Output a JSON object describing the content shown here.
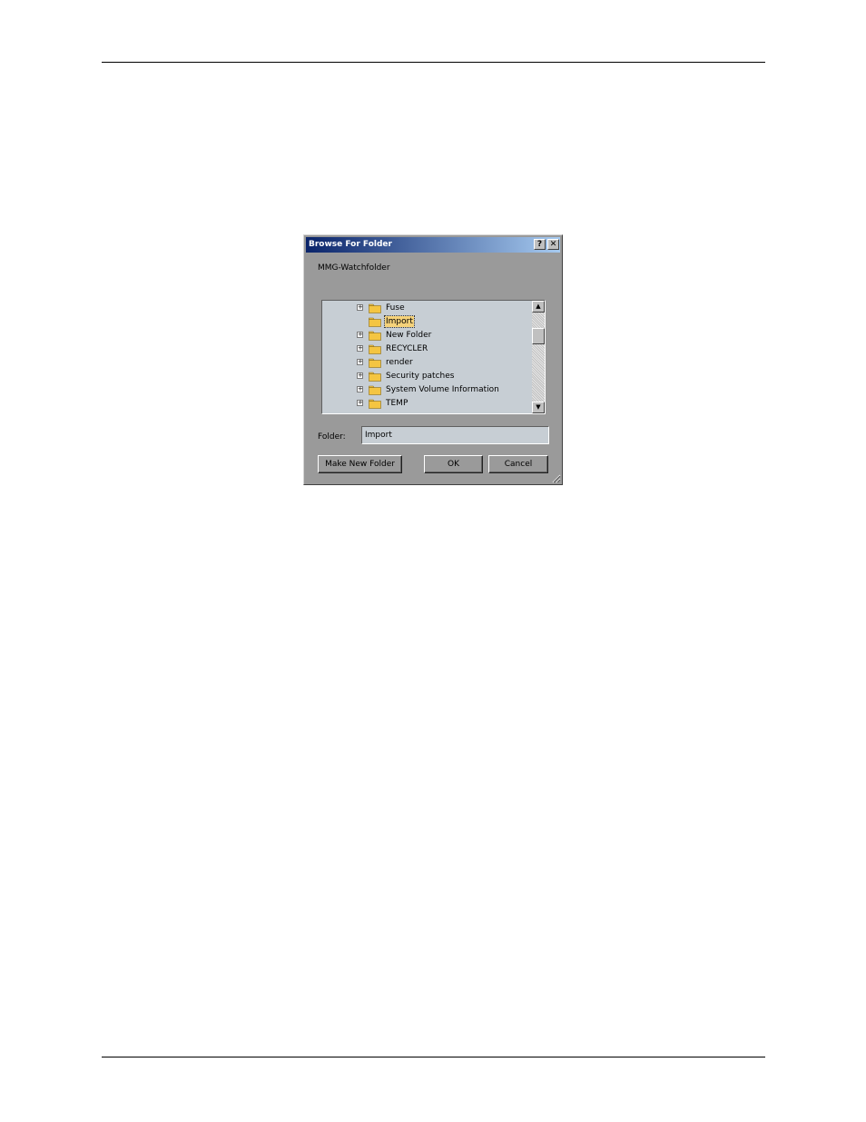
{
  "dialog": {
    "title": "Browse For Folder",
    "help_button": "?",
    "close_button": "✕",
    "instruction": "MMG-Watchfolder",
    "tree": {
      "items": [
        {
          "label": "Fuse",
          "expandable": true,
          "selected": false
        },
        {
          "label": "Import",
          "expandable": false,
          "selected": true
        },
        {
          "label": "New Folder",
          "expandable": true,
          "selected": false
        },
        {
          "label": "RECYCLER",
          "expandable": true,
          "selected": false
        },
        {
          "label": "render",
          "expandable": true,
          "selected": false
        },
        {
          "label": "Security patches",
          "expandable": true,
          "selected": false
        },
        {
          "label": "System Volume Information",
          "expandable": true,
          "selected": false
        },
        {
          "label": "TEMP",
          "expandable": true,
          "selected": false
        }
      ],
      "expander_glyph": "+",
      "scroll_up_glyph": "▲",
      "scroll_down_glyph": "▼"
    },
    "folder_label": "Folder:",
    "folder_value": "Import",
    "buttons": {
      "make_new_folder": "Make New Folder",
      "ok": "OK",
      "cancel": "Cancel"
    },
    "colors": {
      "title_gradient_start": "#0a246a",
      "title_gradient_end": "#a6caf0",
      "dialog_background": "#9a9a9a",
      "field_background": "#c7ced4",
      "selection": "#f5d27a",
      "folder_icon": "#f4c542"
    }
  }
}
